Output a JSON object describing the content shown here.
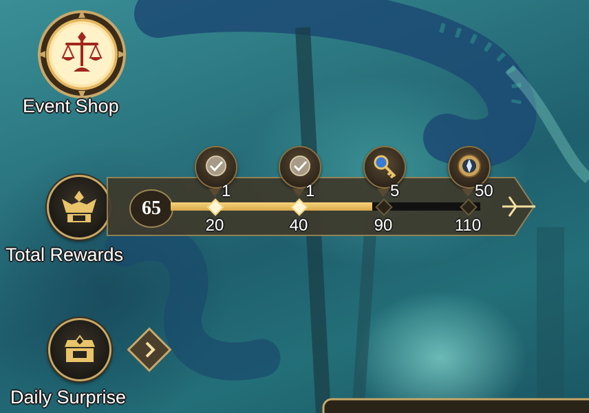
{
  "event_shop": {
    "label": "Event Shop"
  },
  "total_rewards": {
    "label": "Total Rewards",
    "current_points": "65",
    "progress": 0.65,
    "milestones": [
      {
        "threshold": "20",
        "reward_count": "1",
        "reward_icon": "clock-check-icon",
        "reached": true
      },
      {
        "threshold": "40",
        "reward_count": "1",
        "reward_icon": "clock-check-icon",
        "reached": true
      },
      {
        "threshold": "90",
        "reward_count": "5",
        "reward_icon": "key-icon",
        "reached": false
      },
      {
        "threshold": "110",
        "reward_count": "50",
        "reward_icon": "emblem-icon",
        "reached": false
      }
    ]
  },
  "daily_surprise": {
    "label": "Daily Surprise"
  },
  "colors": {
    "gold": "#e9c46a",
    "bar_track": "#111111",
    "panel": "#3f3a2c"
  }
}
